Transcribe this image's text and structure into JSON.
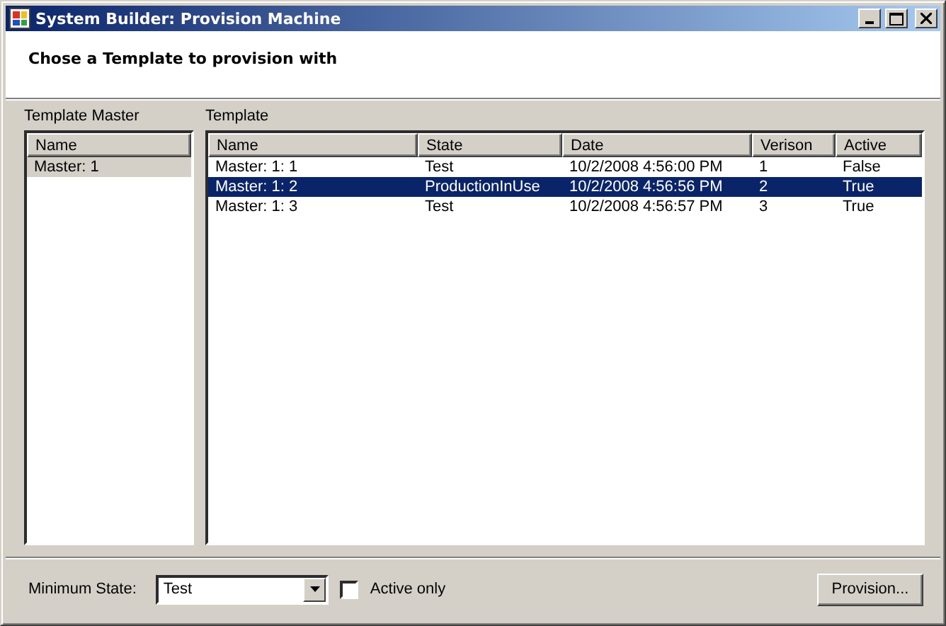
{
  "window": {
    "title": "System Builder: Provision Machine"
  },
  "header": {
    "text": "Chose a Template to provision with"
  },
  "template_master": {
    "label": "Template Master",
    "columns": [
      "Name"
    ],
    "rows": [
      {
        "cells": [
          "Master: 1"
        ],
        "selected": true
      }
    ]
  },
  "template": {
    "label": "Template",
    "columns": [
      "Name",
      "State",
      "Date",
      "Verison",
      "Active"
    ],
    "rows": [
      {
        "cells": [
          "Master: 1: 1",
          "Test",
          "10/2/2008 4:56:00 PM",
          "1",
          "False"
        ],
        "selected": false
      },
      {
        "cells": [
          "Master: 1: 2",
          "ProductionInUse",
          "10/2/2008 4:56:56 PM",
          "2",
          "True"
        ],
        "selected": true
      },
      {
        "cells": [
          "Master: 1: 3",
          "Test",
          "10/2/2008 4:56:57 PM",
          "3",
          "True"
        ],
        "selected": false
      }
    ]
  },
  "footer": {
    "minimum_state_label": "Minimum State:",
    "minimum_state_value": "Test",
    "active_only": {
      "label": "Active only",
      "checked": false
    },
    "provision_button": "Provision..."
  }
}
